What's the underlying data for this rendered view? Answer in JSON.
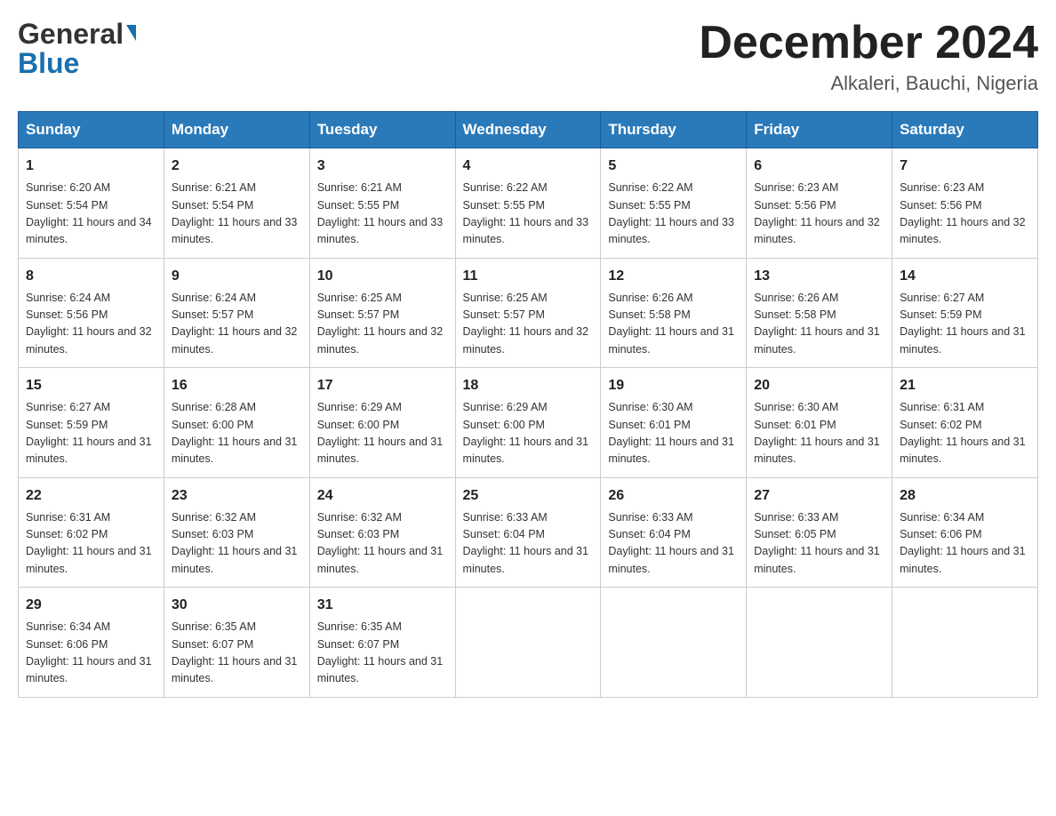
{
  "header": {
    "logo_general": "General",
    "logo_blue": "Blue",
    "month_title": "December 2024",
    "location": "Alkaleri, Bauchi, Nigeria"
  },
  "weekdays": [
    "Sunday",
    "Monday",
    "Tuesday",
    "Wednesday",
    "Thursday",
    "Friday",
    "Saturday"
  ],
  "weeks": [
    [
      {
        "day": "1",
        "sunrise": "6:20 AM",
        "sunset": "5:54 PM",
        "daylight": "11 hours and 34 minutes."
      },
      {
        "day": "2",
        "sunrise": "6:21 AM",
        "sunset": "5:54 PM",
        "daylight": "11 hours and 33 minutes."
      },
      {
        "day": "3",
        "sunrise": "6:21 AM",
        "sunset": "5:55 PM",
        "daylight": "11 hours and 33 minutes."
      },
      {
        "day": "4",
        "sunrise": "6:22 AM",
        "sunset": "5:55 PM",
        "daylight": "11 hours and 33 minutes."
      },
      {
        "day": "5",
        "sunrise": "6:22 AM",
        "sunset": "5:55 PM",
        "daylight": "11 hours and 33 minutes."
      },
      {
        "day": "6",
        "sunrise": "6:23 AM",
        "sunset": "5:56 PM",
        "daylight": "11 hours and 32 minutes."
      },
      {
        "day": "7",
        "sunrise": "6:23 AM",
        "sunset": "5:56 PM",
        "daylight": "11 hours and 32 minutes."
      }
    ],
    [
      {
        "day": "8",
        "sunrise": "6:24 AM",
        "sunset": "5:56 PM",
        "daylight": "11 hours and 32 minutes."
      },
      {
        "day": "9",
        "sunrise": "6:24 AM",
        "sunset": "5:57 PM",
        "daylight": "11 hours and 32 minutes."
      },
      {
        "day": "10",
        "sunrise": "6:25 AM",
        "sunset": "5:57 PM",
        "daylight": "11 hours and 32 minutes."
      },
      {
        "day": "11",
        "sunrise": "6:25 AM",
        "sunset": "5:57 PM",
        "daylight": "11 hours and 32 minutes."
      },
      {
        "day": "12",
        "sunrise": "6:26 AM",
        "sunset": "5:58 PM",
        "daylight": "11 hours and 31 minutes."
      },
      {
        "day": "13",
        "sunrise": "6:26 AM",
        "sunset": "5:58 PM",
        "daylight": "11 hours and 31 minutes."
      },
      {
        "day": "14",
        "sunrise": "6:27 AM",
        "sunset": "5:59 PM",
        "daylight": "11 hours and 31 minutes."
      }
    ],
    [
      {
        "day": "15",
        "sunrise": "6:27 AM",
        "sunset": "5:59 PM",
        "daylight": "11 hours and 31 minutes."
      },
      {
        "day": "16",
        "sunrise": "6:28 AM",
        "sunset": "6:00 PM",
        "daylight": "11 hours and 31 minutes."
      },
      {
        "day": "17",
        "sunrise": "6:29 AM",
        "sunset": "6:00 PM",
        "daylight": "11 hours and 31 minutes."
      },
      {
        "day": "18",
        "sunrise": "6:29 AM",
        "sunset": "6:00 PM",
        "daylight": "11 hours and 31 minutes."
      },
      {
        "day": "19",
        "sunrise": "6:30 AM",
        "sunset": "6:01 PM",
        "daylight": "11 hours and 31 minutes."
      },
      {
        "day": "20",
        "sunrise": "6:30 AM",
        "sunset": "6:01 PM",
        "daylight": "11 hours and 31 minutes."
      },
      {
        "day": "21",
        "sunrise": "6:31 AM",
        "sunset": "6:02 PM",
        "daylight": "11 hours and 31 minutes."
      }
    ],
    [
      {
        "day": "22",
        "sunrise": "6:31 AM",
        "sunset": "6:02 PM",
        "daylight": "11 hours and 31 minutes."
      },
      {
        "day": "23",
        "sunrise": "6:32 AM",
        "sunset": "6:03 PM",
        "daylight": "11 hours and 31 minutes."
      },
      {
        "day": "24",
        "sunrise": "6:32 AM",
        "sunset": "6:03 PM",
        "daylight": "11 hours and 31 minutes."
      },
      {
        "day": "25",
        "sunrise": "6:33 AM",
        "sunset": "6:04 PM",
        "daylight": "11 hours and 31 minutes."
      },
      {
        "day": "26",
        "sunrise": "6:33 AM",
        "sunset": "6:04 PM",
        "daylight": "11 hours and 31 minutes."
      },
      {
        "day": "27",
        "sunrise": "6:33 AM",
        "sunset": "6:05 PM",
        "daylight": "11 hours and 31 minutes."
      },
      {
        "day": "28",
        "sunrise": "6:34 AM",
        "sunset": "6:06 PM",
        "daylight": "11 hours and 31 minutes."
      }
    ],
    [
      {
        "day": "29",
        "sunrise": "6:34 AM",
        "sunset": "6:06 PM",
        "daylight": "11 hours and 31 minutes."
      },
      {
        "day": "30",
        "sunrise": "6:35 AM",
        "sunset": "6:07 PM",
        "daylight": "11 hours and 31 minutes."
      },
      {
        "day": "31",
        "sunrise": "6:35 AM",
        "sunset": "6:07 PM",
        "daylight": "11 hours and 31 minutes."
      },
      null,
      null,
      null,
      null
    ]
  ]
}
